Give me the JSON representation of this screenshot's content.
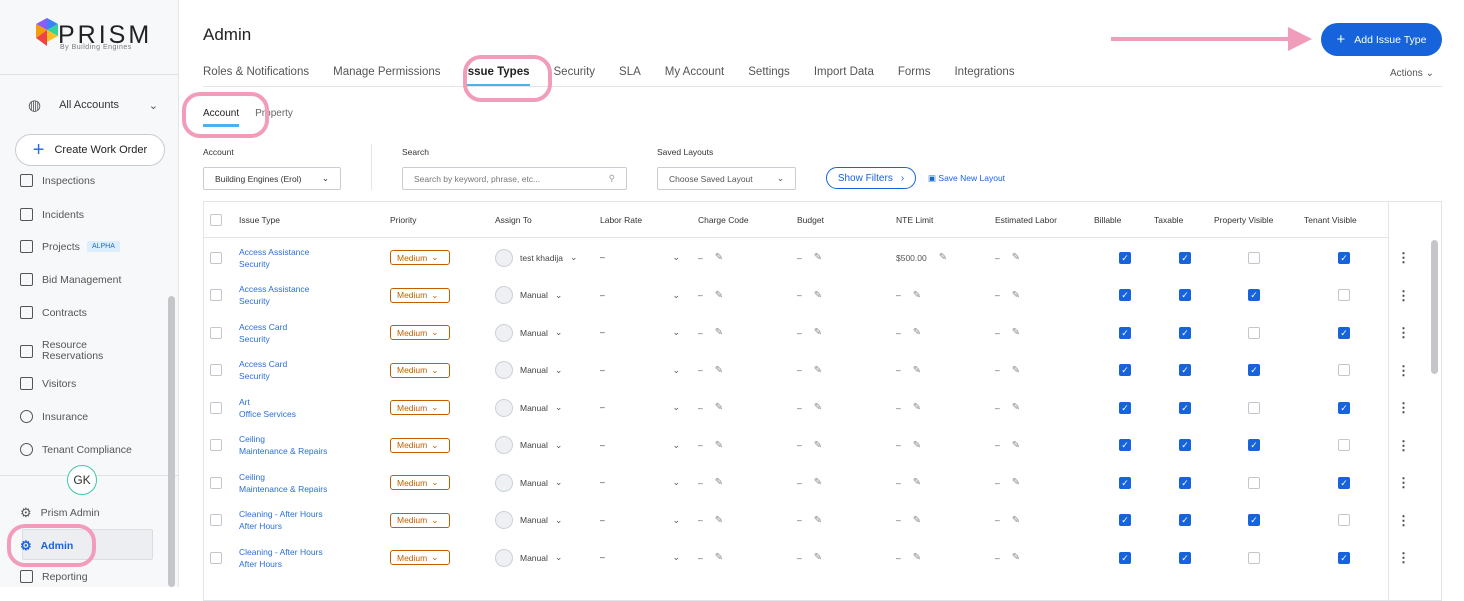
{
  "sidebar": {
    "logo": "PRISM",
    "logo_sub": "By Building Engines",
    "account": "All Accounts",
    "create_btn": "Create Work Order",
    "items": [
      {
        "label": "Inspections"
      },
      {
        "label": "Incidents"
      },
      {
        "label": "Projects",
        "badge": "ALPHA"
      },
      {
        "label": "Bid Management"
      },
      {
        "label": "Contracts"
      },
      {
        "label": "Resource Reservations"
      },
      {
        "label": "Visitors"
      },
      {
        "label": "Insurance"
      },
      {
        "label": "Tenant Compliance"
      }
    ],
    "avatar": "GK",
    "bottom": [
      {
        "label": "Prism Admin"
      },
      {
        "label": "Admin"
      },
      {
        "label": "Reporting"
      }
    ]
  },
  "header": {
    "title": "Admin",
    "add_btn": "Add Issue Type",
    "actions": "Actions"
  },
  "tabs": [
    "Roles & Notifications",
    "Manage Permissions",
    "Issue Types",
    "Security",
    "SLA",
    "My Account",
    "Settings",
    "Import Data",
    "Forms",
    "Integrations"
  ],
  "subtabs": [
    "Account",
    "Property"
  ],
  "filters": {
    "account_label": "Account",
    "account_value": "Building Engines (Erol)",
    "search_label": "Search",
    "search_placeholder": "Search by keyword, phrase, etc...",
    "layouts_label": "Saved Layouts",
    "layouts_value": "Choose Saved Layout",
    "show_filters": "Show Filters",
    "save_layout": "Save New Layout"
  },
  "table": {
    "columns": [
      "Issue Type",
      "Priority",
      "Assign To",
      "Labor Rate",
      "Charge Code",
      "Budget",
      "NTE Limit",
      "Estimated Labor",
      "Billable",
      "Taxable",
      "Property Visible",
      "Tenant Visible"
    ],
    "rows": [
      {
        "name": "Access Assistance",
        "category": "Security",
        "priority": "Medium",
        "assign": "test khadija",
        "labor": "–",
        "charge": "–",
        "budget": "–",
        "nte": "$500.00",
        "est": "–",
        "billable": true,
        "taxable": true,
        "prop": false,
        "tenant": true
      },
      {
        "name": "Access Assistance",
        "category": "Security",
        "priority": "Medium",
        "assign": "Manual",
        "labor": "–",
        "charge": "–",
        "budget": "–",
        "nte": "–",
        "est": "–",
        "billable": true,
        "taxable": true,
        "prop": true,
        "tenant": false
      },
      {
        "name": "Access Card",
        "category": "Security",
        "priority": "Medium",
        "assign": "Manual",
        "labor": "–",
        "charge": "–",
        "budget": "–",
        "nte": "–",
        "est": "–",
        "billable": true,
        "taxable": true,
        "prop": false,
        "tenant": true
      },
      {
        "name": "Access Card",
        "category": "Security",
        "priority": "Medium",
        "assign": "Manual",
        "labor": "–",
        "charge": "–",
        "budget": "–",
        "nte": "–",
        "est": "–",
        "billable": true,
        "taxable": true,
        "prop": true,
        "tenant": false
      },
      {
        "name": "Art",
        "category": "Office Services",
        "priority": "Medium",
        "assign": "Manual",
        "labor": "–",
        "charge": "–",
        "budget": "–",
        "nte": "–",
        "est": "–",
        "billable": true,
        "taxable": true,
        "prop": false,
        "tenant": true
      },
      {
        "name": "Ceiling",
        "category": "Maintenance & Repairs",
        "priority": "Medium",
        "assign": "Manual",
        "labor": "–",
        "charge": "–",
        "budget": "–",
        "nte": "–",
        "est": "–",
        "billable": true,
        "taxable": true,
        "prop": true,
        "tenant": false
      },
      {
        "name": "Ceiling",
        "category": "Maintenance & Repairs",
        "priority": "Medium",
        "assign": "Manual",
        "labor": "–",
        "charge": "–",
        "budget": "–",
        "nte": "–",
        "est": "–",
        "billable": true,
        "taxable": true,
        "prop": false,
        "tenant": true
      },
      {
        "name": "Cleaning - After Hours",
        "category": "After Hours",
        "priority": "Medium",
        "assign": "Manual",
        "labor": "–",
        "charge": "–",
        "budget": "–",
        "nte": "–",
        "est": "–",
        "billable": true,
        "taxable": true,
        "prop": true,
        "tenant": false
      },
      {
        "name": "Cleaning - After Hours",
        "category": "After Hours",
        "priority": "Medium",
        "assign": "Manual",
        "labor": "–",
        "charge": "–",
        "budget": "–",
        "nte": "–",
        "est": "–",
        "billable": true,
        "taxable": true,
        "prop": false,
        "tenant": true
      }
    ]
  }
}
